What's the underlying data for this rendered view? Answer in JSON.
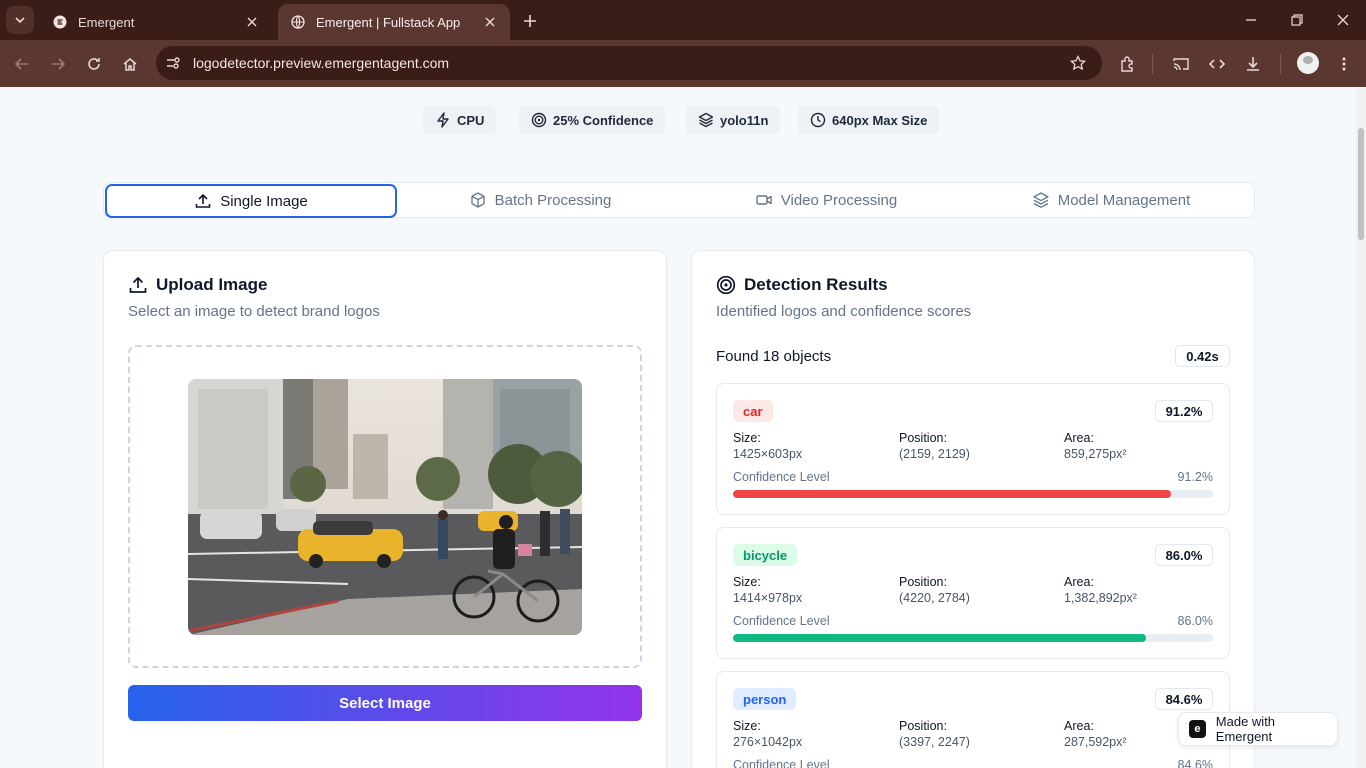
{
  "browser": {
    "tabs": [
      {
        "title": "Emergent",
        "active": false
      },
      {
        "title": "Emergent | Fullstack App",
        "active": true
      }
    ],
    "url": "logodetector.preview.emergentagent.com"
  },
  "status_chips": [
    {
      "label": "CPU",
      "icon": "bolt-icon"
    },
    {
      "label": "25% Confidence",
      "icon": "target-icon"
    },
    {
      "label": "yolo11n",
      "icon": "layers-icon"
    },
    {
      "label": "640px Max Size",
      "icon": "clock-icon"
    }
  ],
  "mode_tabs": [
    {
      "label": "Single Image",
      "icon": "upload-icon",
      "active": true
    },
    {
      "label": "Batch Processing",
      "icon": "box-icon",
      "active": false
    },
    {
      "label": "Video Processing",
      "icon": "video-icon",
      "active": false
    },
    {
      "label": "Model Management",
      "icon": "layers-icon",
      "active": false
    }
  ],
  "upload": {
    "title": "Upload Image",
    "subtitle": "Select an image to detect brand logos",
    "button": "Select Image"
  },
  "results": {
    "title": "Detection Results",
    "subtitle": "Identified logos and confidence scores",
    "found": "Found 18 objects",
    "time": "0.42s",
    "detections": [
      {
        "label": "car",
        "confidence": "91.2%",
        "fraction": 0.912,
        "size": "1425×603px",
        "position": "(2159, 2129)",
        "area": "859,275px²",
        "color": "#ef4444",
        "badge_bg": "#fde8e8",
        "badge_fg": "#dc2626"
      },
      {
        "label": "bicycle",
        "confidence": "86.0%",
        "fraction": 0.86,
        "size": "1414×978px",
        "position": "(4220, 2784)",
        "area": "1,382,892px²",
        "color": "#10b981",
        "badge_bg": "#dcfce7",
        "badge_fg": "#059669"
      },
      {
        "label": "person",
        "confidence": "84.6%",
        "fraction": 0.846,
        "size": "276×1042px",
        "position": "(3397, 2247)",
        "area": "287,592px²",
        "color": "#3b82f6",
        "badge_bg": "#e0ecff",
        "badge_fg": "#2563eb"
      }
    ],
    "field_labels": {
      "size": "Size:",
      "position": "Position:",
      "area": "Area:",
      "confidence": "Confidence Level"
    }
  },
  "made_with": "Made with Emergent"
}
